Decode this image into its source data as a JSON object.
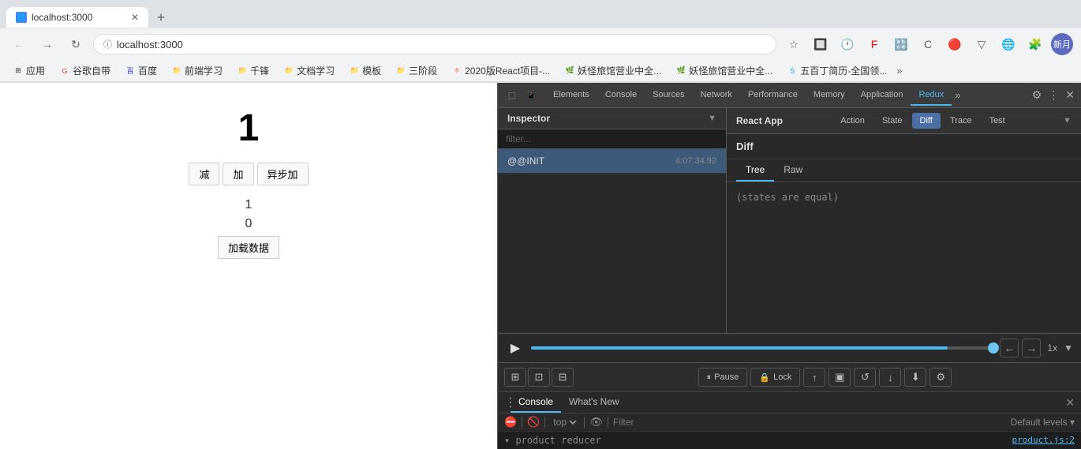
{
  "browser": {
    "url": "localhost:3000",
    "tab_title": "localhost:3000"
  },
  "bookmarks": [
    {
      "label": "应用",
      "color": "#4285f4"
    },
    {
      "label": "谷歌自带",
      "color": "#ea4335"
    },
    {
      "label": "百度",
      "color": "#2932e1"
    },
    {
      "label": "前端学习",
      "color": "#fbbc04"
    },
    {
      "label": "千锋",
      "color": "#fbbc04"
    },
    {
      "label": "文档学习",
      "color": "#34a853"
    },
    {
      "label": "模板",
      "color": "#fbbc04"
    },
    {
      "label": "三阶段",
      "color": "#fbbc04"
    },
    {
      "label": "2020版React项目-...",
      "color": "#f4511e"
    },
    {
      "label": "妖怪旅馆营业中全...",
      "color": "#4caf50"
    },
    {
      "label": "妖怪旅馆营业中全...",
      "color": "#4caf50"
    },
    {
      "label": "五百丁简历-全国领...",
      "color": "#2196f3"
    }
  ],
  "page": {
    "counter": "1",
    "btn_minus": "减",
    "btn_plus": "加",
    "btn_async": "异步加",
    "sub_value1": "1",
    "sub_value2": "0",
    "btn_load": "加载数据"
  },
  "devtools": {
    "tabs": [
      "Elements",
      "Console",
      "Sources",
      "Network",
      "Performance",
      "Memory",
      "Application",
      "Redux"
    ],
    "active_tab": "Redux",
    "inspector_title": "Inspector",
    "react_app_title": "React App"
  },
  "redux": {
    "filter_placeholder": "filter...",
    "actions": [
      {
        "name": "@@INIT",
        "time": "4:07:34.92"
      }
    ],
    "selected_action": 0,
    "diff_tabs": [
      "Action",
      "State",
      "Diff",
      "Trace",
      "Test"
    ],
    "active_diff_tab": "Diff",
    "section_title": "Diff",
    "tree_tab": "Tree",
    "raw_tab": "Raw",
    "active_tree_tab": "Tree",
    "diff_content": "(states are equal)"
  },
  "playback": {
    "speed": "1x",
    "progress": 90
  },
  "action_buttons": [
    {
      "label": "⏸ Pause",
      "icon": "pause"
    },
    {
      "label": "🔒 Lock",
      "icon": "lock"
    },
    {
      "label": "↑",
      "icon": "up"
    },
    {
      "label": "⬜",
      "icon": "square"
    },
    {
      "label": "↺",
      "icon": "refresh"
    },
    {
      "label": "↓",
      "icon": "down"
    },
    {
      "label": "↓",
      "icon": "down2"
    },
    {
      "label": "⚙",
      "icon": "settings"
    }
  ],
  "console": {
    "tabs": [
      "Console",
      "What's New"
    ],
    "active_tab": "Console",
    "top_value": "top",
    "filter_placeholder": "Filter",
    "levels_label": "Default levels ▾",
    "log_text": "▾ product reducer",
    "log_file": "product.js:2"
  }
}
